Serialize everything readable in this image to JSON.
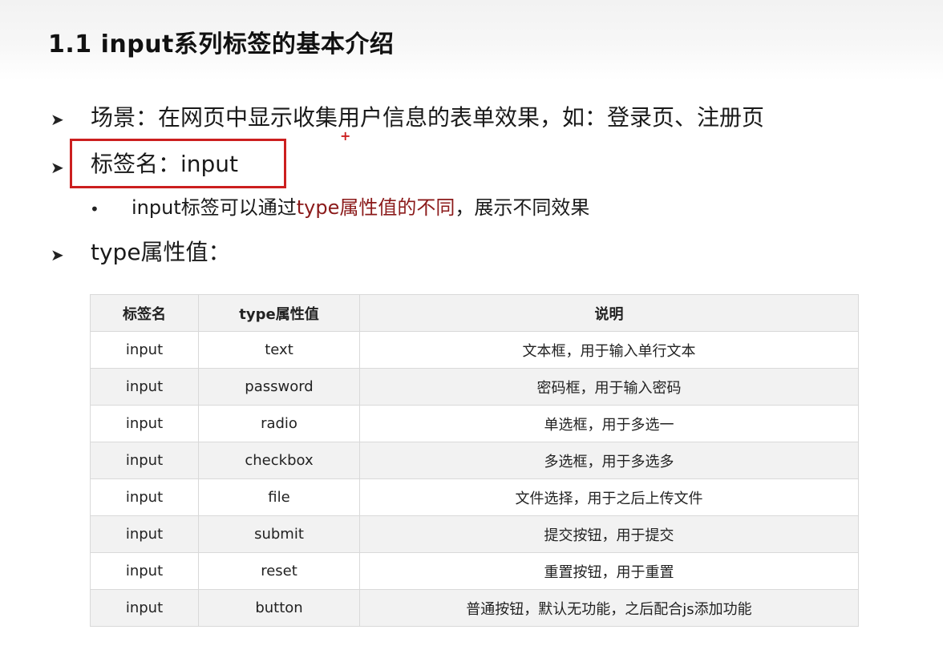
{
  "title": "1.1 input系列标签的基本介绍",
  "bullets": {
    "scene": "场景：在网页中显示收集用户信息的表单效果，如：登录页、注册页",
    "tag_name": "标签名：input",
    "sub_prefix": "input标签可以通过",
    "sub_highlight": "type属性值的不同",
    "sub_suffix": "，展示不同效果",
    "type_values": "type属性值："
  },
  "colors": {
    "highlight_box": "#cc1f1f",
    "emphasis_text": "#8b1a1a",
    "header_row_bg": "#f2f2f2"
  },
  "table": {
    "headers": [
      "标签名",
      "type属性值",
      "说明"
    ],
    "rows": [
      [
        "input",
        "text",
        "文本框，用于输入单行文本"
      ],
      [
        "input",
        "password",
        "密码框，用于输入密码"
      ],
      [
        "input",
        "radio",
        "单选框，用于多选一"
      ],
      [
        "input",
        "checkbox",
        "多选框，用于多选多"
      ],
      [
        "input",
        "file",
        "文件选择，用于之后上传文件"
      ],
      [
        "input",
        "submit",
        "提交按钮，用于提交"
      ],
      [
        "input",
        "reset",
        "重置按钮，用于重置"
      ],
      [
        "input",
        "button",
        "普通按钮，默认无功能，之后配合js添加功能"
      ]
    ]
  }
}
